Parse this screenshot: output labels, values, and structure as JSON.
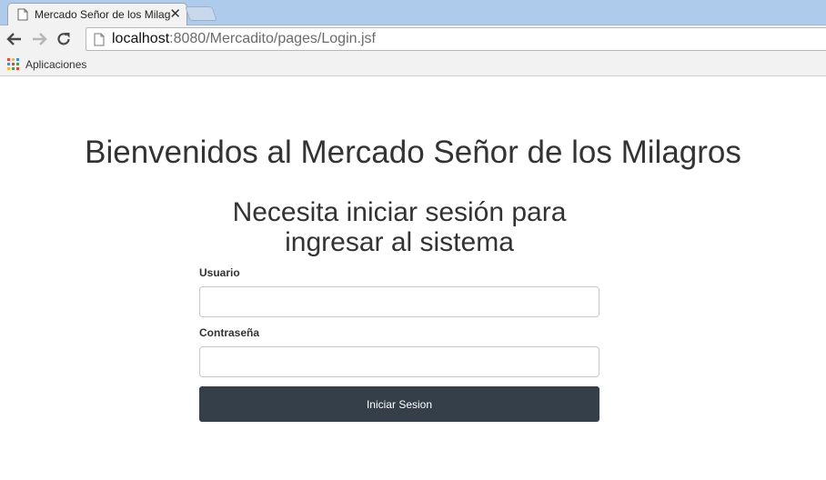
{
  "browser": {
    "tab": {
      "title": "Mercado Señor de los Milagros",
      "close_glyph": "✕"
    },
    "omnibox": {
      "url_host": "localhost",
      "url_rest": ":8080/Mercadito/pages/Login.jsf"
    },
    "bookmarks": {
      "apps_label": "Aplicaciones"
    },
    "icons": {
      "back": "back-arrow-icon",
      "forward": "forward-arrow-icon",
      "reload": "reload-icon",
      "page": "page-icon",
      "apps": "apps-grid-icon"
    }
  },
  "page": {
    "heading": "Bienvenidos al Mercado Señor de los Milagros",
    "subheading": "Necesita iniciar sesión para ingresar al sistema",
    "form": {
      "username_label": "Usuario",
      "username_value": "",
      "password_label": "Contraseña",
      "password_value": "",
      "submit_label": "Iniciar Sesion"
    }
  },
  "colors": {
    "tabstrip": "#aecbeb",
    "button_bg": "#343f4a",
    "text": "#333333"
  }
}
